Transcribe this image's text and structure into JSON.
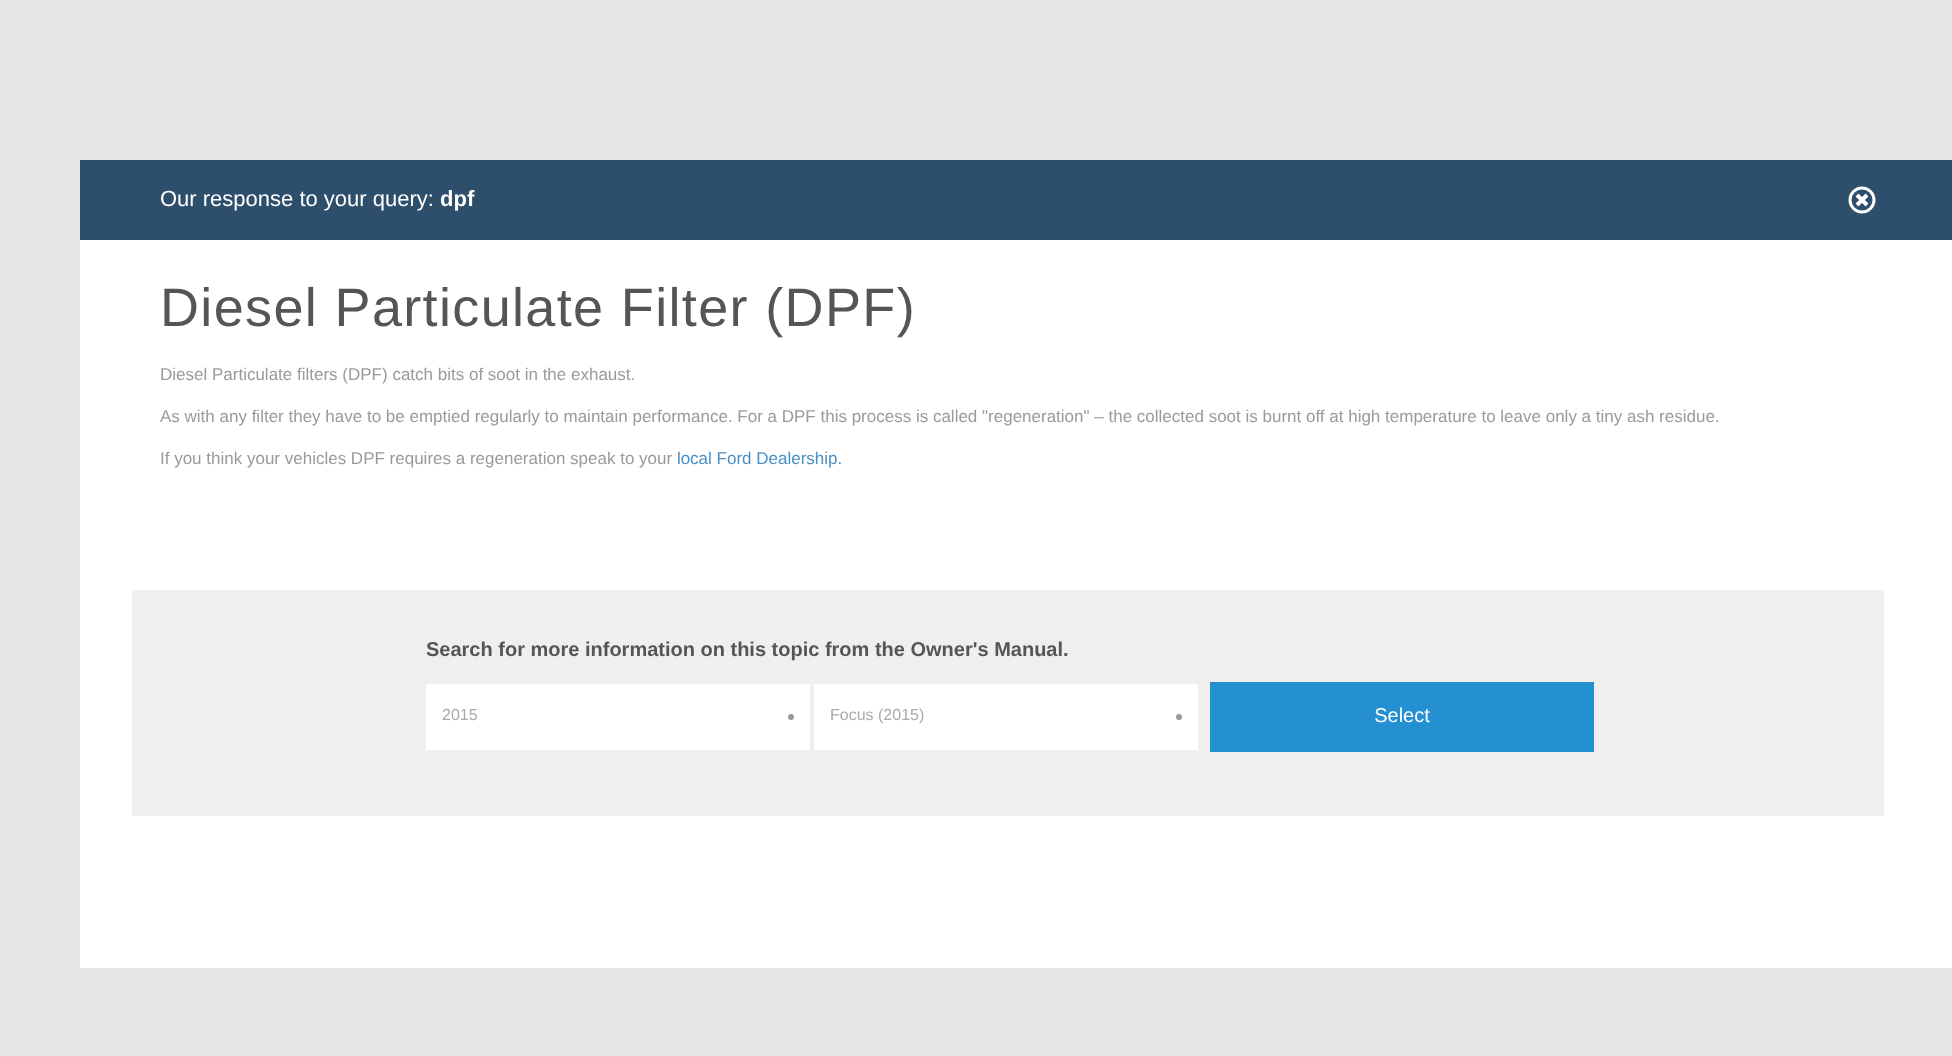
{
  "header": {
    "text": "Our response to your query: **dpf**"
  },
  "article": {
    "title": "Diesel Particulate Filter (DPF)",
    "paragraphs": [
      {
        "text": "Diesel Particulate filters (DPF) catch bits of soot in the exhaust."
      },
      {
        "text": "As with any filter they have to be emptied regularly to maintain performance. For a DPF this process is called \"regeneration\" – the collected soot is burnt off at high temperature to leave only a tiny ash residue."
      },
      {
        "text": "If you think your vehicles DPF requires a regeneration speak to your ",
        "link": "local Ford Dealership."
      }
    ]
  },
  "search": {
    "heading": "Search for more information on this topic from the Owner's Manual.",
    "year": "2015",
    "model": "Focus (2015)",
    "button": "Select"
  }
}
